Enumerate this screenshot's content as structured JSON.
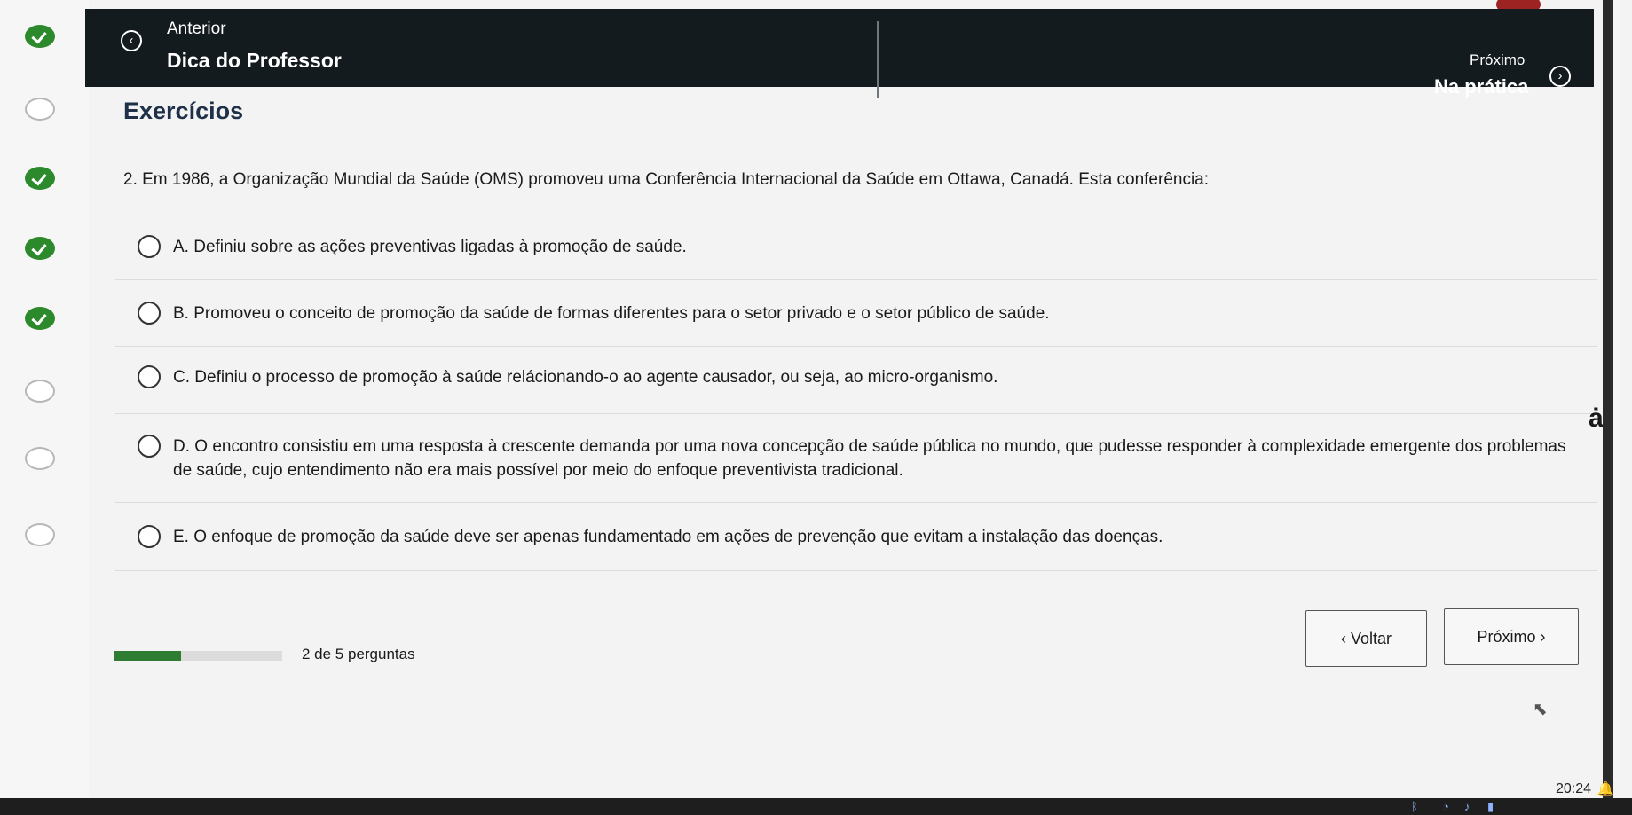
{
  "rail": {
    "steps": [
      "done",
      "todo",
      "done",
      "done",
      "done",
      "todo",
      "todo",
      "todo"
    ]
  },
  "header": {
    "prev_small": "Anterior",
    "prev_title": "Dica do Professor",
    "next_small": "Próximo",
    "next_title": "Na prática"
  },
  "section": {
    "title": "Exercícios"
  },
  "question": {
    "text": "2. Em 1986, a Organização Mundial da Saúde (OMS) promoveu uma Conferência Internacional da Saúde em Ottawa, Canadá. Esta conferência:",
    "options": [
      {
        "label": "A. Definiu sobre as ações preventivas ligadas à promoção de saúde."
      },
      {
        "label": "B. Promoveu o conceito de promoção da saúde de formas diferentes para o setor privado e o setor público de saúde."
      },
      {
        "label": "C. Definiu o processo de promoção à saúde relácionando-o ao agente causador, ou seja, ao micro-organismo."
      },
      {
        "label": "D. O encontro consistiu em uma resposta à crescente demanda por uma nova concepção de saúde pública no mundo, que pudesse responder à complexidade emergente dos problemas de saúde, cujo entendimento não era mais possível por meio do enfoque preventivista tradicional."
      },
      {
        "label": "E. O enfoque de promoção da saúde deve ser apenas fundamentado em ações de prevenção que evitam a instalação das doenças."
      }
    ]
  },
  "footer": {
    "progress_fraction": 0.4,
    "progress_text": "2 de 5 perguntas",
    "back_label": "Voltar",
    "next_label": "Próximo"
  },
  "taskbar": {
    "time": "20:24"
  },
  "icons": {
    "prev": "chevron-left-circle-icon",
    "next": "chevron-right-circle-icon",
    "help": "accessibility-icon"
  },
  "colors": {
    "header_bg": "#141b1f",
    "done": "#2c8a2c",
    "progress": "#2e7d32",
    "title": "#1e3149"
  }
}
